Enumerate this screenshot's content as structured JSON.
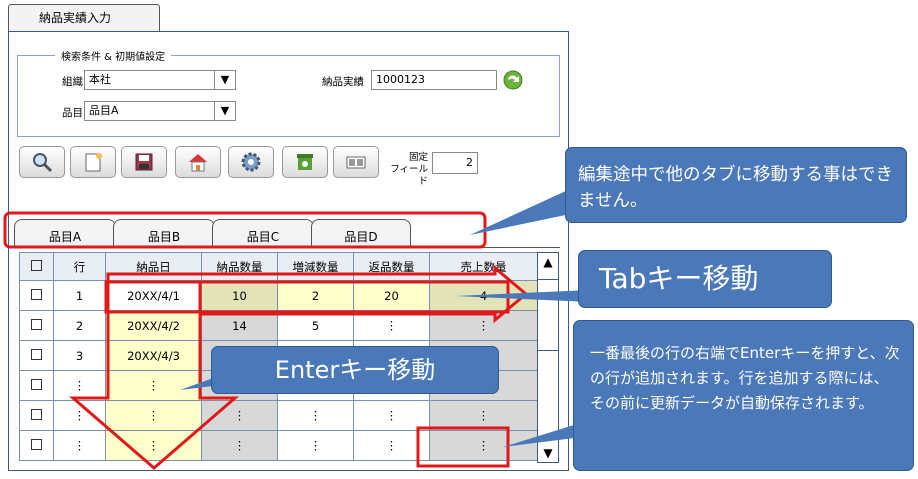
{
  "window": {
    "tab_label": "納品実績入力"
  },
  "search": {
    "legend": "検索条件 & 初期値設定",
    "org_label": "組織",
    "org_value": "本社",
    "item_label": "品目",
    "item_value": "品目A",
    "delivery_label": "納品実績",
    "delivery_value": "1000123"
  },
  "toolbar": {
    "buttons": [
      "search-icon",
      "new-document-icon",
      "save-icon",
      "home-icon",
      "gear-icon",
      "clear-icon",
      "layout-icon"
    ],
    "fixed_field_label_1": "固定",
    "fixed_field_label_2": "フィールド",
    "fixed_field_value": "2"
  },
  "tabs": [
    "品目A",
    "品目B",
    "品目C",
    "品目D"
  ],
  "grid": {
    "headers": [
      "☐",
      "行",
      "納品日",
      "納品数量",
      "増減数量",
      "返品数量",
      "売上数量"
    ],
    "rows": [
      [
        "☐",
        "1",
        "20XX/4/1",
        "10",
        "2",
        "20",
        "4"
      ],
      [
        "☐",
        "2",
        "20XX/4/2",
        "14",
        "5",
        "︙",
        "︙"
      ],
      [
        "☐",
        "3",
        "20XX/4/3",
        "",
        "",
        "",
        ""
      ],
      [
        "☐",
        "︙",
        "︙",
        "",
        "",
        "",
        ""
      ],
      [
        "☐",
        "︙",
        "︙",
        "︙",
        "︙",
        "︙",
        "︙"
      ],
      [
        "☐",
        "︙",
        "︙",
        "︙",
        "︙",
        "︙",
        "︙"
      ]
    ]
  },
  "callouts": {
    "tab_note": "編集途中で他のタブに移動する事はできません。",
    "tab_move": "Tabキー移動",
    "enter_move": "Enterキー移動",
    "add_row_note": "一番最後の行の右端でEnterキーを押すと、次の行が追加されます。行を追加する際には、その前に更新データが自動保存されます。"
  },
  "colors": {
    "accent": "#4a78b8",
    "highlight_red": "#e01818",
    "row_highlight": "#ffffcc"
  }
}
